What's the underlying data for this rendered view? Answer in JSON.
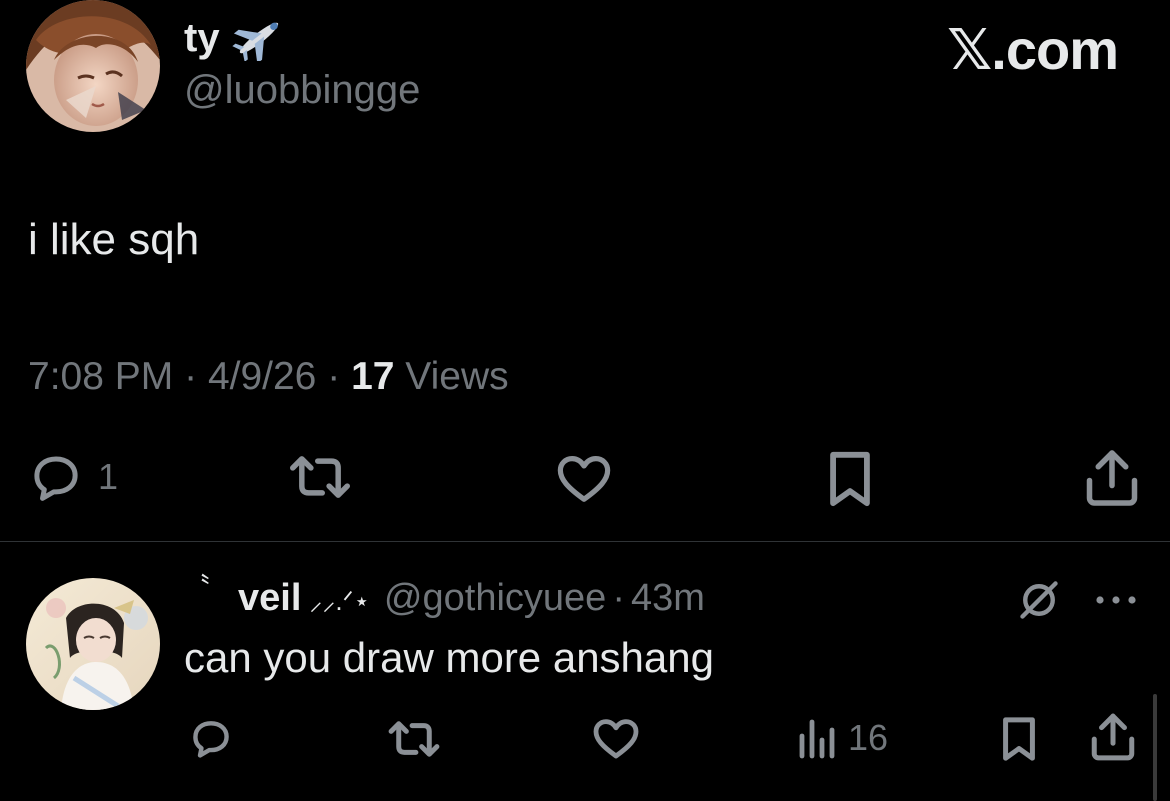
{
  "colors": {
    "background": "#000000",
    "text_primary": "#e7e9ea",
    "text_secondary": "#71767b",
    "divider": "#2f3336"
  },
  "main_tweet": {
    "author_name": "ty",
    "author_emoji": "airplane-icon",
    "handle": "@luobbingge",
    "brand": "𝕏.com",
    "text": "i like sqh",
    "time": "7:08 PM",
    "date": "4/9/26",
    "views_count": "17",
    "views_label": "Views",
    "separator": "·",
    "actions": {
      "reply_icon": "reply-icon",
      "reply_count": "1",
      "retweet_icon": "retweet-icon",
      "like_icon": "heart-icon",
      "bookmark_icon": "bookmark-icon",
      "share_icon": "share-icon"
    }
  },
  "reply": {
    "prefix_mark": "〝",
    "author_name": "veil",
    "name_decoration": "⸝⸝.ᐟ⋆",
    "handle": "@gothicyuee",
    "separator": "·",
    "time": "43m",
    "text": "can you draw more anshang",
    "views_count": "16",
    "actions": {
      "reply_icon": "reply-icon",
      "retweet_icon": "retweet-icon",
      "like_icon": "heart-icon",
      "views_icon": "views-chart-icon",
      "bookmark_icon": "bookmark-icon",
      "share_icon": "share-icon",
      "grok_icon": "grok-icon",
      "more_icon": "more-dots-icon"
    }
  }
}
